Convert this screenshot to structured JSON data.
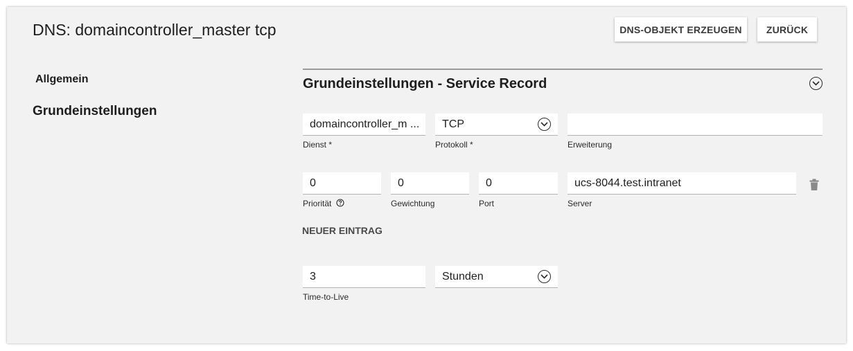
{
  "page": {
    "title": "DNS: domaincontroller_master tcp"
  },
  "toolbar": {
    "create_label": "DNS-OBJEKT ERZEUGEN",
    "back_label": "ZURÜCK"
  },
  "sidebar": {
    "items": [
      {
        "label": "Allgemein",
        "active": false
      },
      {
        "label": "Grundeinstellungen",
        "active": true
      }
    ]
  },
  "section": {
    "title": "Grundeinstellungen - Service Record",
    "toggle_icon": "chevron-down-circle-icon"
  },
  "service": {
    "dienst": {
      "value": "domaincontroller_m ...",
      "label": "Dienst *"
    },
    "protokoll": {
      "value": "TCP",
      "label": "Protokoll *"
    },
    "erweiterung": {
      "value": "",
      "label": "Erweiterung"
    }
  },
  "location": {
    "prioritaet": {
      "value": "0",
      "label": "Priorität"
    },
    "gewichtung": {
      "value": "0",
      "label": "Gewichtung"
    },
    "port": {
      "value": "0",
      "label": "Port"
    },
    "server": {
      "value": "ucs-8044.test.intranet",
      "label": "Server"
    },
    "help_icon": "help-circle-icon",
    "delete_icon": "trash-icon"
  },
  "new_entry_label": "NEUER EINTRAG",
  "ttl": {
    "value": "3",
    "label": "Time-to-Live",
    "unit": "Stunden"
  },
  "colors": {
    "panel_bg": "#f2f2f2",
    "field_bg": "#ffffff",
    "divider": "#9a9a9a"
  }
}
